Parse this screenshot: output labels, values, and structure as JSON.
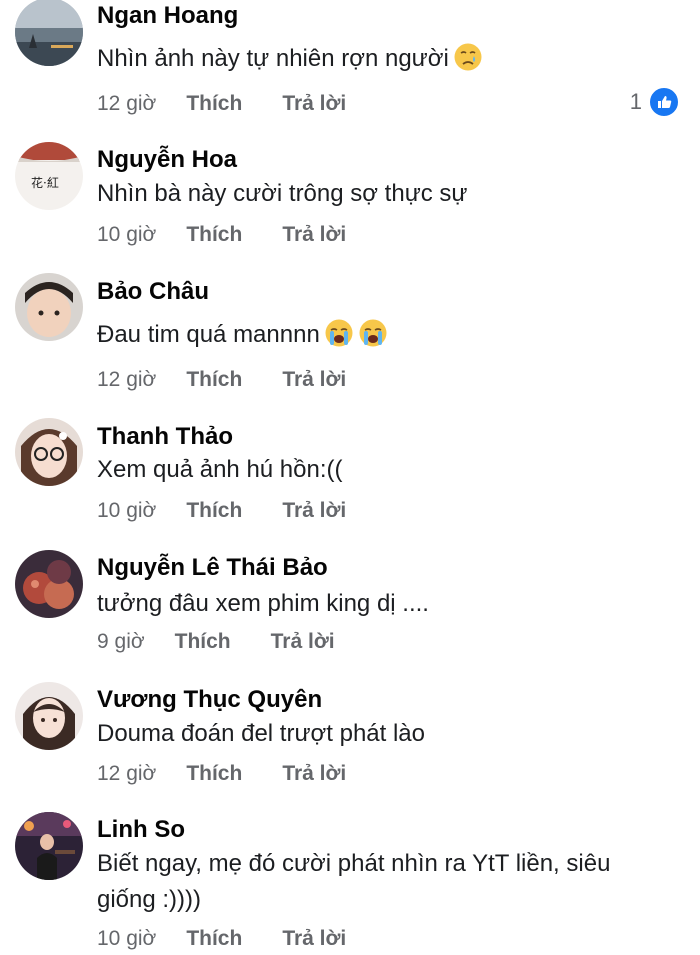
{
  "comments": [
    {
      "author": "Ngan Hoang",
      "text": "Nhìn ảnh này tự nhiên rợn người",
      "emoji": [
        "crying-face-emoji"
      ],
      "time": "12 giờ",
      "like_label": "Thích",
      "reply_label": "Trả lời",
      "reaction_count": "1"
    },
    {
      "author": "Nguyễn Hoa",
      "text": "Nhìn bà này cười trông sợ thực sự",
      "emoji": [],
      "time": "10 giờ",
      "like_label": "Thích",
      "reply_label": "Trả lời"
    },
    {
      "author": "Bảo Châu",
      "text": "Đau tim quá mannnn",
      "emoji": [
        "loudly-crying-face-emoji",
        "loudly-crying-face-emoji"
      ],
      "time": "12 giờ",
      "like_label": "Thích",
      "reply_label": "Trả lời"
    },
    {
      "author": "Thanh Thảo",
      "text": "Xem quả ảnh hú hồn:((",
      "emoji": [],
      "time": "10 giờ",
      "like_label": "Thích",
      "reply_label": "Trả lời"
    },
    {
      "author": "Nguyễn Lê Thái Bảo",
      "text": "tưởng đâu xem phim king dị ....",
      "emoji": [],
      "time": "9 giờ",
      "like_label": "Thích",
      "reply_label": "Trả lời"
    },
    {
      "author": "Vương Thục Quyên",
      "text": "Douma đoán đel trượt phát lào",
      "emoji": [],
      "time": "12 giờ",
      "like_label": "Thích",
      "reply_label": "Trả lời"
    },
    {
      "author": "Linh So",
      "text": "Biết ngay, mẹ đó cười phát nhìn ra YtT liền, siêu giống :))))",
      "emoji": [],
      "time": "10 giờ",
      "like_label": "Thích",
      "reply_label": "Trả lời"
    }
  ],
  "colors": {
    "meta_text": "#65676b",
    "like_badge": "#1877f2"
  }
}
